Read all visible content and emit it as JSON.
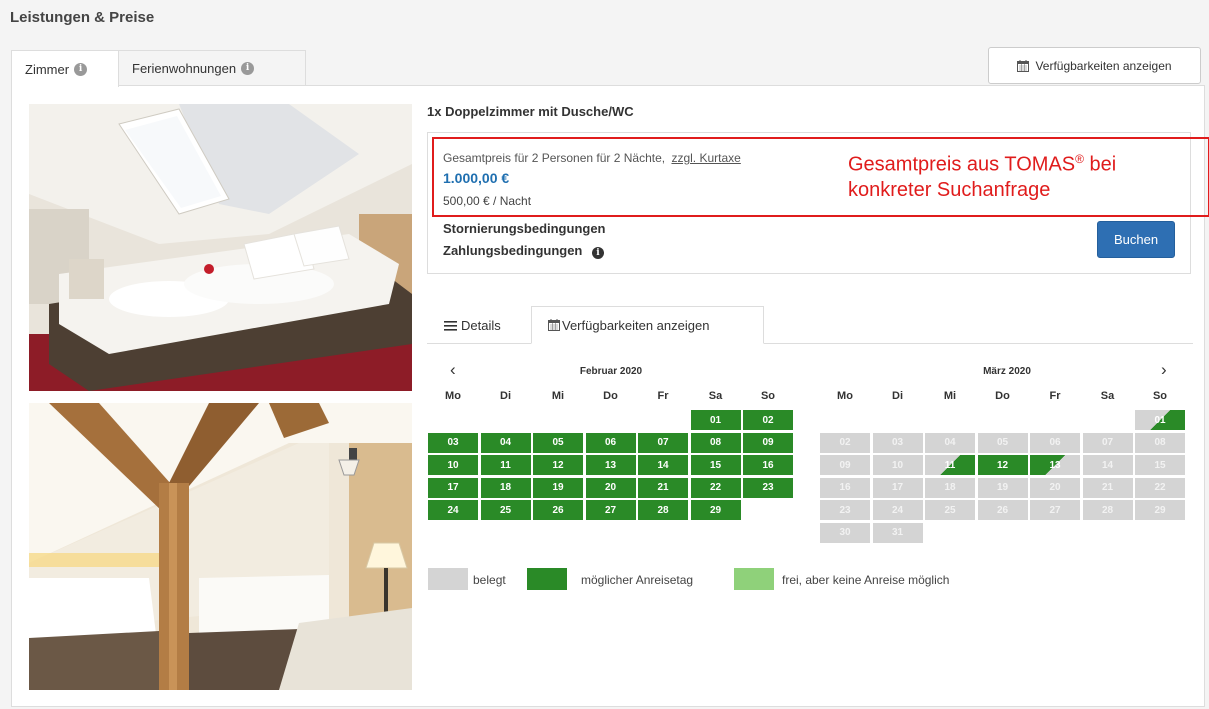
{
  "page": {
    "title": "Leistungen & Preise"
  },
  "tabs": [
    {
      "label": "Zimmer"
    },
    {
      "label": "Ferienwohnungen"
    }
  ],
  "top_button": {
    "label": "Verfügbarkeiten anzeigen",
    "icon": "calendar-icon"
  },
  "room": {
    "title": "1x Doppelzimmer mit Dusche/WC",
    "price_description": "Gesamtpreis für 2 Personen für 2 Nächte,",
    "kurtaxe_link": "zzgl. Kurtaxe",
    "price_total": "1.000,00 €",
    "price_per_night": "500,00 € / Nacht",
    "storno_link": "Stornierungsbedingungen",
    "zahlung_link": "Zahlungsbedingungen",
    "book_button": "Buchen"
  },
  "annotation": {
    "text_line1_a": "Gesamtpreis aus TOMAS",
    "text_line1_sup": "®",
    "text_line1_b": " bei",
    "text_line2": "konkreter Suchanfrage",
    "color": "#e01c1c"
  },
  "subtabs": {
    "details": "Details",
    "availability": "Verfügbarkeiten anzeigen"
  },
  "calendar": {
    "prev": "‹",
    "next": "›",
    "weekdays": [
      "Mo",
      "Di",
      "Mi",
      "Do",
      "Fr",
      "Sa",
      "So"
    ],
    "months": [
      {
        "title": "Februar 2020",
        "days": [
          {
            "d": "01",
            "s": "g"
          },
          {
            "d": "02",
            "s": "g"
          },
          {
            "d": "03",
            "s": "g"
          },
          {
            "d": "04",
            "s": "g"
          },
          {
            "d": "05",
            "s": "g"
          },
          {
            "d": "06",
            "s": "g"
          },
          {
            "d": "07",
            "s": "g"
          },
          {
            "d": "08",
            "s": "g"
          },
          {
            "d": "09",
            "s": "g"
          },
          {
            "d": "10",
            "s": "g"
          },
          {
            "d": "11",
            "s": "g"
          },
          {
            "d": "12",
            "s": "g"
          },
          {
            "d": "13",
            "s": "g"
          },
          {
            "d": "14",
            "s": "g"
          },
          {
            "d": "15",
            "s": "g"
          },
          {
            "d": "16",
            "s": "g"
          },
          {
            "d": "17",
            "s": "g"
          },
          {
            "d": "18",
            "s": "g"
          },
          {
            "d": "19",
            "s": "g"
          },
          {
            "d": "20",
            "s": "g"
          },
          {
            "d": "21",
            "s": "g"
          },
          {
            "d": "22",
            "s": "g"
          },
          {
            "d": "23",
            "s": "g"
          },
          {
            "d": "24",
            "s": "g"
          },
          {
            "d": "25",
            "s": "g"
          },
          {
            "d": "26",
            "s": "g"
          },
          {
            "d": "27",
            "s": "g"
          },
          {
            "d": "28",
            "s": "g"
          },
          {
            "d": "29",
            "s": "g"
          }
        ]
      },
      {
        "title": "März 2020",
        "days": [
          {
            "d": "01",
            "s": "dl"
          },
          {
            "d": "02",
            "s": "x"
          },
          {
            "d": "03",
            "s": "x"
          },
          {
            "d": "04",
            "s": "x"
          },
          {
            "d": "05",
            "s": "x"
          },
          {
            "d": "06",
            "s": "x"
          },
          {
            "d": "07",
            "s": "x"
          },
          {
            "d": "08",
            "s": "x"
          },
          {
            "d": "09",
            "s": "x"
          },
          {
            "d": "10",
            "s": "x"
          },
          {
            "d": "11",
            "s": "dl"
          },
          {
            "d": "12",
            "s": "g"
          },
          {
            "d": "13",
            "s": "ur"
          },
          {
            "d": "14",
            "s": "x"
          },
          {
            "d": "15",
            "s": "x"
          },
          {
            "d": "16",
            "s": "x"
          },
          {
            "d": "17",
            "s": "x"
          },
          {
            "d": "18",
            "s": "x"
          },
          {
            "d": "19",
            "s": "x"
          },
          {
            "d": "20",
            "s": "x"
          },
          {
            "d": "21",
            "s": "x"
          },
          {
            "d": "22",
            "s": "x"
          },
          {
            "d": "23",
            "s": "x"
          },
          {
            "d": "24",
            "s": "x"
          },
          {
            "d": "25",
            "s": "x"
          },
          {
            "d": "26",
            "s": "x"
          },
          {
            "d": "27",
            "s": "x"
          },
          {
            "d": "28",
            "s": "x"
          },
          {
            "d": "29",
            "s": "x"
          },
          {
            "d": "30",
            "s": "x"
          },
          {
            "d": "31",
            "s": "x"
          }
        ]
      }
    ],
    "colors": {
      "available": "#2a8a27",
      "occupied": "#d4d4d4",
      "free_no_arrival": "#8fd17a"
    }
  },
  "legend": [
    {
      "label": "belegt",
      "color": "#d4d4d4"
    },
    {
      "label": "möglicher Anreisetag",
      "color": "#2a8a27"
    },
    {
      "label": "frei, aber keine Anreise möglich",
      "color": "#8fd17a"
    }
  ]
}
